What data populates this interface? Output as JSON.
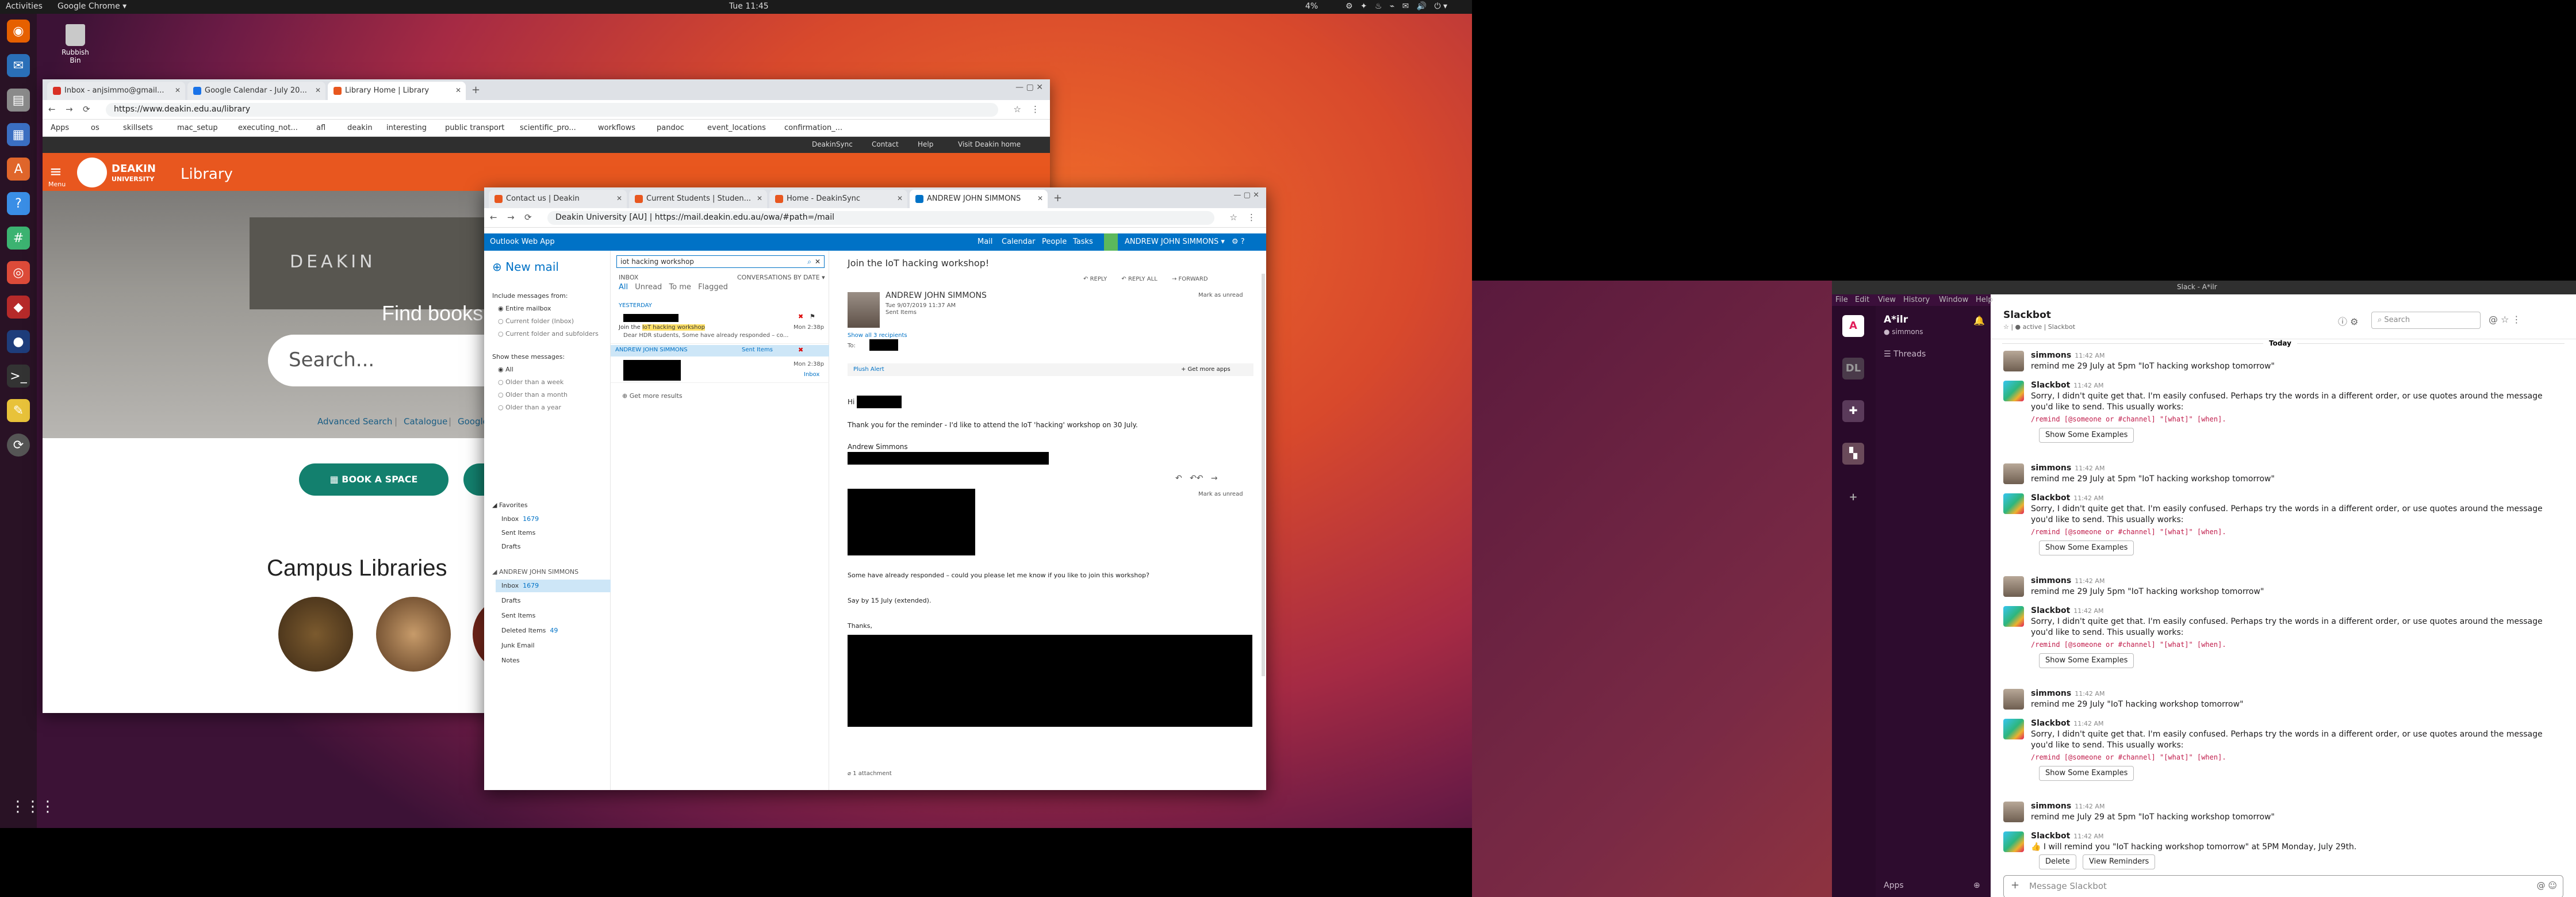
{
  "desktop": {
    "activities": "Activities",
    "app_menu": "Google Chrome ▾",
    "clock": "Tue 11:45",
    "battery": "4%",
    "trash_label": "Rubbish Bin"
  },
  "chromeA": {
    "tabs": [
      {
        "label": "Inbox - anjsimmo@gmail..."
      },
      {
        "label": "Google Calendar - July 20..."
      },
      {
        "label": "Library Home | Library"
      }
    ],
    "url": "https://www.deakin.edu.au/library",
    "bookmarks": [
      "Apps",
      "os",
      "skillsets",
      "mac_setup",
      "executing_not...",
      "afl",
      "deakin",
      "interesting",
      "public transport",
      "scientific_pro...",
      "workflows",
      "pandoc",
      "event_locations",
      "confirmation_..."
    ]
  },
  "deakin": {
    "top_links": [
      "DeakinSync",
      "Contact",
      "Help",
      "Visit Deakin home"
    ],
    "menu_label": "Menu",
    "logo_line1": "DEAKIN",
    "logo_line2": "UNIVERSITY",
    "library_label": "Library",
    "hero_sign": "DEAKIN",
    "find_books": "Find books",
    "search_placeholder": "Search...",
    "links": [
      "Advanced Search",
      "|",
      "Catalogue",
      "|",
      "Google"
    ],
    "book_space": "BOOK A SPACE",
    "campus_libraries": "Campus Libraries"
  },
  "chromeB": {
    "tabs": [
      {
        "label": "Contact us | Deakin"
      },
      {
        "label": "Current Students | Studen..."
      },
      {
        "label": "Home - DeakinSync"
      },
      {
        "label": "ANDREW JOHN SIMMONS"
      }
    ],
    "url": "Deakin University [AU]  |  https://mail.deakin.edu.au/owa/#path=/mail"
  },
  "owa": {
    "app_name": "Outlook Web App",
    "nav": [
      "Mail",
      "Calendar",
      "People",
      "Tasks"
    ],
    "user": "ANDREW JOHN SIMMONS ▾",
    "new_mail": "New mail",
    "search_value": "iot hacking workshop",
    "include_title": "Include messages from:",
    "include_opts": [
      "Entire mailbox",
      "Current folder (Inbox)",
      "Current folder and subfolders"
    ],
    "show_title": "Show these messages:",
    "show_opts": [
      "All",
      "Older than a week",
      "Older than a month",
      "Older than a year"
    ],
    "favorites_title": "Favorites",
    "favorites": [
      {
        "name": "Inbox",
        "count": "1679"
      },
      {
        "name": "Sent Items",
        "count": ""
      },
      {
        "name": "Drafts",
        "count": ""
      }
    ],
    "account_title": "ANDREW JOHN SIMMONS",
    "folders": [
      {
        "name": "Inbox",
        "count": "1679"
      },
      {
        "name": "Drafts",
        "count": ""
      },
      {
        "name": "Sent Items",
        "count": ""
      },
      {
        "name": "Deleted Items",
        "count": "49"
      },
      {
        "name": "Junk Email",
        "count": ""
      },
      {
        "name": "Notes",
        "count": ""
      }
    ],
    "list_inbox_label": "INBOX",
    "list_sort": "CONVERSATIONS BY DATE ▾",
    "filters": [
      "All",
      "Unread",
      "To me",
      "Flagged"
    ],
    "group_yesterday": "YESTERDAY",
    "items": [
      {
        "subject_pre": "Join the ",
        "subject_hl": "IoT hacking workshop",
        "date": "Mon 2:38p",
        "preview": "Dear HDR students,  Some have already responded – co..."
      },
      {
        "sender": "ANDREW JOHN SIMMONS",
        "folder": "Sent Items",
        "date": "Mon 2:38p"
      },
      {
        "date": "Mon 2:38p",
        "folder": "Inbox"
      }
    ],
    "more_results": "Get more results",
    "read_subject": "Join the IoT hacking workshop!",
    "actions": [
      "REPLY",
      "REPLY ALL",
      "FORWARD"
    ],
    "mark_unread": "Mark as unread",
    "sender_name": "ANDREW JOHN SIMMONS",
    "sent_date": "Tue 9/07/2019 11:37 AM",
    "sent_folder": "Sent Items",
    "show_recipients": "Show all 3 recipients",
    "to_label": "To:",
    "tab_plain": "Plush Alert",
    "get_more_apps": "+  Get more apps",
    "hi": "Hi",
    "body1": "Thank you for the reminder - I'd like to attend the IoT 'hacking' workshop on 30 July.",
    "signature": "Andrew Simmons",
    "quoted1": "Some have already responded – could you please let me know if you like to join this workshop?",
    "quoted2": "Say by 15 July (extended).",
    "thanks": "Thanks,",
    "attachment": "1 attachment"
  },
  "slack": {
    "window_title": "Slack - A*ilr",
    "menu": [
      "File",
      "Edit",
      "View",
      "History",
      "Window",
      "Help"
    ],
    "workspace": "A*ilr",
    "user": "simmons",
    "threads": "Threads",
    "apps": "Apps",
    "channel": "Slackbot",
    "channel_sub": "☆  |  ● active  |  Slackbot",
    "search_placeholder": "Search",
    "day_divider": "Today",
    "messages": [
      {
        "author": "simmons",
        "time": "11:42 AM",
        "text": "remind me 29 July at  5pm \"IoT hacking workshop tomorrow\""
      },
      {
        "author": "Slackbot",
        "time": "11:42 AM",
        "text": "Sorry, I didn't quite get that. I'm easily confused. Perhaps try the words in a different order, or use quotes around the message you'd like to send. This usually works:",
        "code": "/remind [@someone or #channel] \"[what]\" [when].",
        "button": "Show Some Examples"
      },
      {
        "author": "simmons",
        "time": "11:42 AM",
        "text": "remind me 29 July at 5pm \"IoT hacking workshop tomorrow\""
      },
      {
        "author": "Slackbot",
        "time": "11:42 AM",
        "text": "Sorry, I didn't quite get that. I'm easily confused. Perhaps try the words in a different order, or use quotes around the message you'd like to send. This usually works:",
        "code": "/remind [@someone or #channel] \"[what]\" [when].",
        "button": "Show Some Examples"
      },
      {
        "author": "simmons",
        "time": "11:42 AM",
        "text": "remind me 29 July 5pm \"IoT hacking workshop tomorrow\""
      },
      {
        "author": "Slackbot",
        "time": "11:42 AM",
        "text": "Sorry, I didn't quite get that. I'm easily confused. Perhaps try the words in a different order, or use quotes around the message you'd like to send. This usually works:",
        "code": "/remind [@someone or #channel] \"[what]\" [when].",
        "button": "Show Some Examples"
      },
      {
        "author": "simmons",
        "time": "11:42 AM",
        "text": "remind me 29 July \"IoT hacking workshop tomorrow\""
      },
      {
        "author": "Slackbot",
        "time": "11:42 AM",
        "text": "Sorry, I didn't quite get that. I'm easily confused. Perhaps try the words in a different order, or use quotes around the message you'd like to send. This usually works:",
        "code": "/remind [@someone or #channel] \"[what]\" [when].",
        "button": "Show Some Examples"
      },
      {
        "author": "simmons",
        "time": "11:42 AM",
        "text": "remind me July 29 at 5pm \"IoT hacking workshop tomorrow\""
      },
      {
        "author": "Slackbot",
        "time": "11:42 AM",
        "text": "👍 I will remind you \"IoT hacking workshop tomorrow\" at 5PM Monday, July 29th.",
        "buttons": [
          "Delete",
          "View Reminders"
        ]
      }
    ],
    "composer_placeholder": "Message Slackbot"
  }
}
